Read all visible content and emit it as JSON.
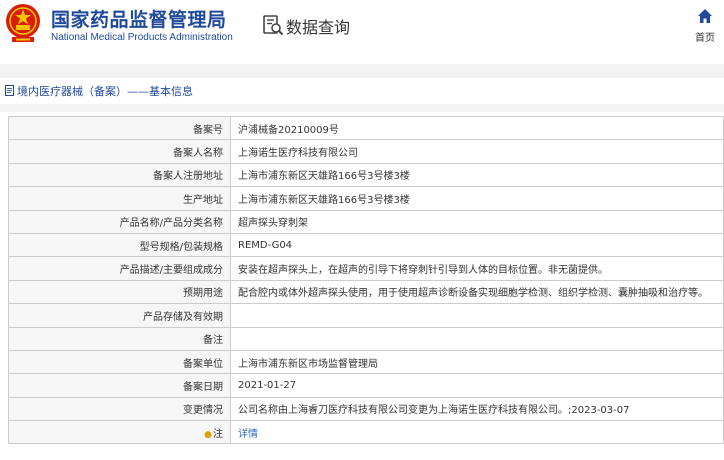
{
  "header": {
    "org_name_cn": "国家药品监督管理局",
    "org_name_en": "National Medical Products Administration",
    "query_title": "数据查询",
    "home_label": "首页",
    "colors": {
      "brand_blue": "#1f4a9c",
      "emblem_red": "#d81e06",
      "emblem_gold": "#f5c400"
    }
  },
  "breadcrumb": {
    "text": "境内医疗器械（备案）——基本信息"
  },
  "record": {
    "rows": [
      {
        "label": "备案号",
        "value": "沪浦械备20210009号"
      },
      {
        "label": "备案人名称",
        "value": "上海诺生医疗科技有限公司"
      },
      {
        "label": "备案人注册地址",
        "value": "上海市浦东新区天雄路166号3号楼3楼"
      },
      {
        "label": "生产地址",
        "value": "上海市浦东新区天雄路166号3号楼3楼"
      },
      {
        "label": "产品名称/产品分类名称",
        "value": "超声探头穿刺架"
      },
      {
        "label": "型号规格/包装规格",
        "value": "REMD-G04"
      },
      {
        "label": "产品描述/主要组成成分",
        "value": "安装在超声探头上，在超声的引导下将穿刺针引导到人体的目标位置。非无菌提供。"
      },
      {
        "label": "预期用途",
        "value": "配合腔内或体外超声探头使用，用于使用超声诊断设备实现细胞学检测、组织学检测、囊肿抽吸和治疗等。"
      },
      {
        "label": "产品存储及有效期",
        "value": ""
      },
      {
        "label": "备注",
        "value": ""
      },
      {
        "label": "备案单位",
        "value": "上海市浦东新区市场监督管理局"
      },
      {
        "label": "备案日期",
        "value": "2021-01-27"
      },
      {
        "label": "变更情况",
        "value": "公司名称由上海睿刀医疗科技有限公司变更为上海诺生医疗科技有限公司。;2023-03-07"
      }
    ],
    "note": {
      "label": "注",
      "link": "详情",
      "icon": "warning-bulb-icon"
    }
  }
}
